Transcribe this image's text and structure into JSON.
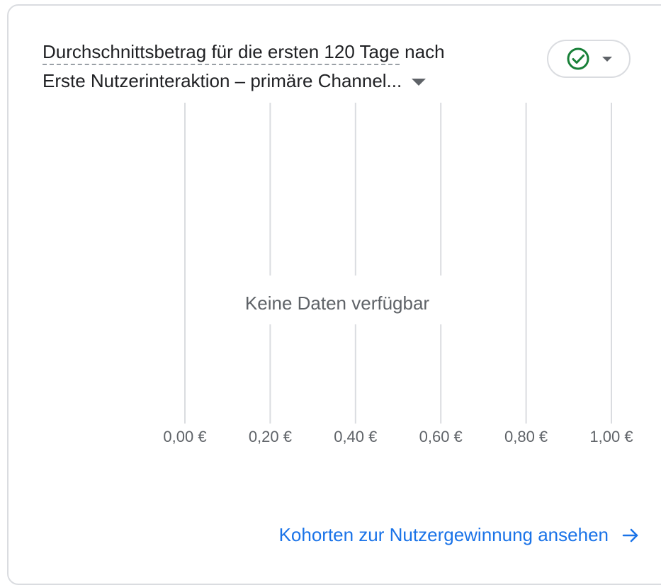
{
  "card": {
    "title_metric": "Durchschnittsbetrag für die ersten 120 Tage",
    "title_connector": " nach",
    "title_dimension": "Erste Nutzerinteraktion – primäre Channel...",
    "status_icon": "check-circle-icon",
    "status_color": "#188038"
  },
  "chart_data": {
    "type": "bar",
    "categories": [],
    "values": [],
    "xlim": [
      0,
      1
    ],
    "x_ticks": [
      0,
      0.2,
      0.4,
      0.6,
      0.8,
      1.0
    ],
    "x_tick_labels": [
      "0,00 €",
      "0,20 €",
      "0,40 €",
      "0,60 €",
      "0,80 €",
      "1,00 €"
    ],
    "grid": true,
    "empty_message": "Keine Daten verfügbar"
  },
  "footer": {
    "link_label": "Kohorten zur Nutzergewinnung ansehen",
    "link_icon": "arrow-right-icon",
    "link_color": "#1a73e8"
  }
}
